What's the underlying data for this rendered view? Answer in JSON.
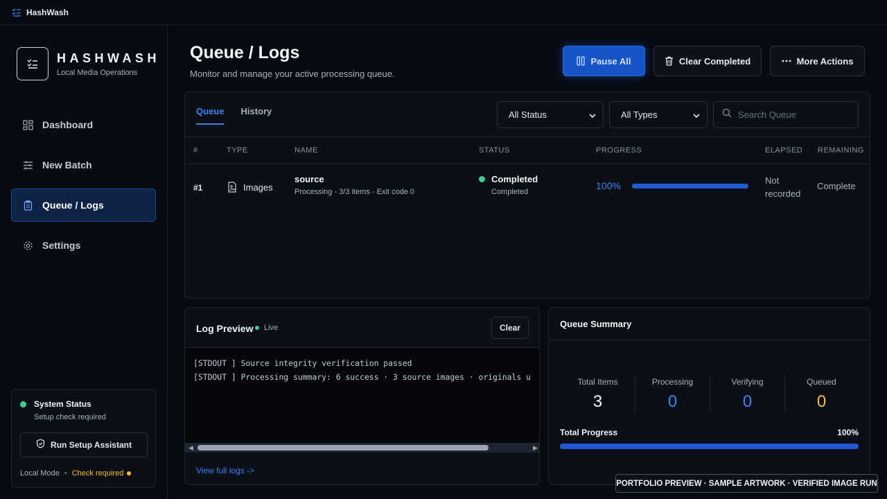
{
  "app": {
    "window_title": "HashWash"
  },
  "brand": {
    "name": "HASHWASH",
    "subtitle": "Local Media Operations"
  },
  "sidebar": {
    "items": [
      {
        "label": "Dashboard",
        "icon": "dashboard-icon",
        "active": false
      },
      {
        "label": "New Batch",
        "icon": "sliders-icon",
        "active": false
      },
      {
        "label": "Queue / Logs",
        "icon": "clipboard-icon",
        "active": true
      },
      {
        "label": "Settings",
        "icon": "gear-icon",
        "active": false
      }
    ]
  },
  "system_status": {
    "title": "System Status",
    "subtitle": "Setup check required",
    "button_label": "Run Setup Assistant",
    "mode": "Local Mode",
    "check": "Check required",
    "status_color": "#34d399",
    "warning_color": "#fbbf24"
  },
  "header": {
    "title": "Queue / Logs",
    "subtitle": "Monitor and manage your active processing queue.",
    "pause_label": "Pause All",
    "clear_label": "Clear Completed",
    "more_label": "More Actions"
  },
  "queue": {
    "tabs": [
      {
        "label": "Queue",
        "active": true
      },
      {
        "label": "History",
        "active": false
      }
    ],
    "status_filter": "All Status",
    "type_filter": "All Types",
    "search_placeholder": "Search Queue",
    "columns": [
      "#",
      "TYPE",
      "NAME",
      "STATUS",
      "PROGRESS",
      "ELAPSED",
      "REMAINING"
    ],
    "rows": [
      {
        "num": "#1",
        "type": "Images",
        "name": "source",
        "detail": "Processing - 3/3 items - Exit code 0",
        "status": "Completed",
        "status_detail": "Completed",
        "progress_label": "100%",
        "progress": 1.0,
        "elapsed": "Not recorded",
        "remaining": "Complete"
      }
    ]
  },
  "log": {
    "title": "Log Preview",
    "live_label": "Live",
    "clear_label": "Clear",
    "lines": [
      "[STDOUT ] Source integrity verification passed",
      "[STDOUT ] Processing summary: 6 success · 3 source images · originals u"
    ],
    "link_label": "View full logs ->"
  },
  "summary": {
    "title": "Queue Summary",
    "stats": [
      {
        "label": "Total Items",
        "value": "3",
        "color": "#f5f7fa"
      },
      {
        "label": "Processing",
        "value": "0",
        "color": "#3b82f6"
      },
      {
        "label": "Verifying",
        "value": "0",
        "color": "#3b82f6"
      },
      {
        "label": "Queued",
        "value": "0",
        "color": "#fbbf24"
      }
    ],
    "total_progress_label": "Total Progress",
    "total_progress_value": "100%",
    "total_progress": 1.0
  },
  "watermark": "PORTFOLIO PREVIEW · SAMPLE ARTWORK · VERIFIED IMAGE RUN",
  "colors": {
    "accent": "#3b82f6",
    "accent_strong": "#1554c7",
    "background": "#070a10"
  }
}
